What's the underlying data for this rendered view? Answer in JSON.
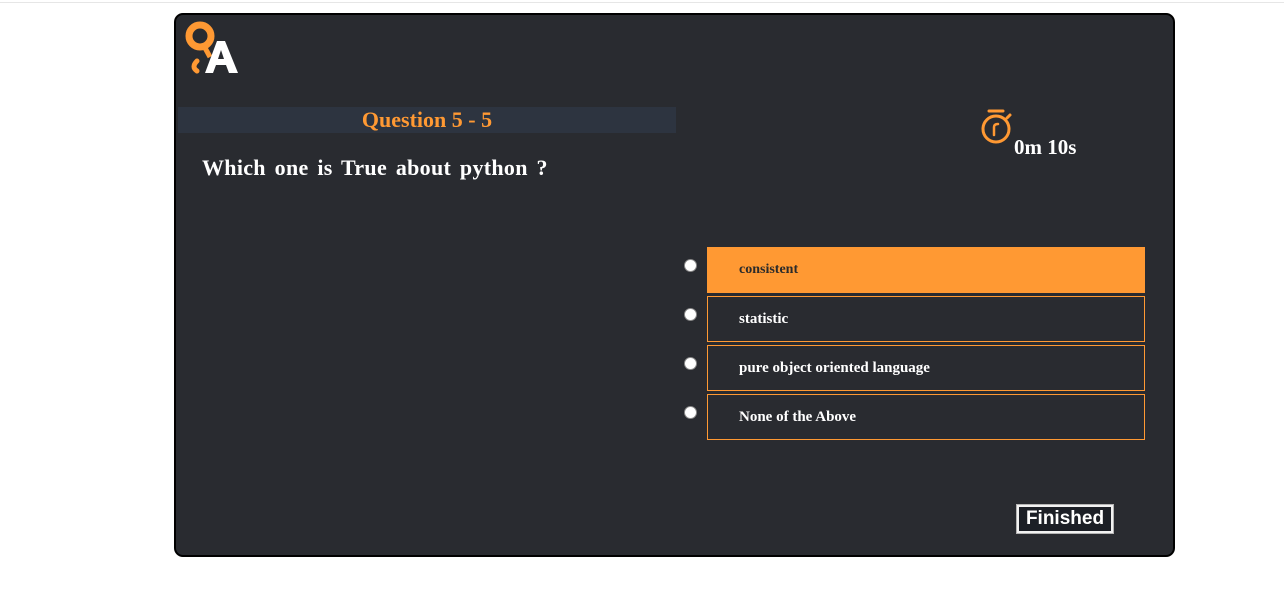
{
  "logo": {
    "letters": "QA",
    "accent": "#ff9933"
  },
  "question": {
    "header": "Question 5 - 5",
    "text": "Which one is True about python ?"
  },
  "timer": {
    "icon": "stopwatch-icon",
    "value": "0m 10s"
  },
  "options": [
    {
      "label": "consistent",
      "selected": true
    },
    {
      "label": "statistic",
      "selected": false
    },
    {
      "label": "pure object oriented language",
      "selected": false
    },
    {
      "label": "None of the Above",
      "selected": false
    }
  ],
  "actions": {
    "finished_label": "Finished"
  },
  "colors": {
    "card_bg": "#292b30",
    "accent": "#ff9933",
    "header_bg": "#2d3440"
  }
}
